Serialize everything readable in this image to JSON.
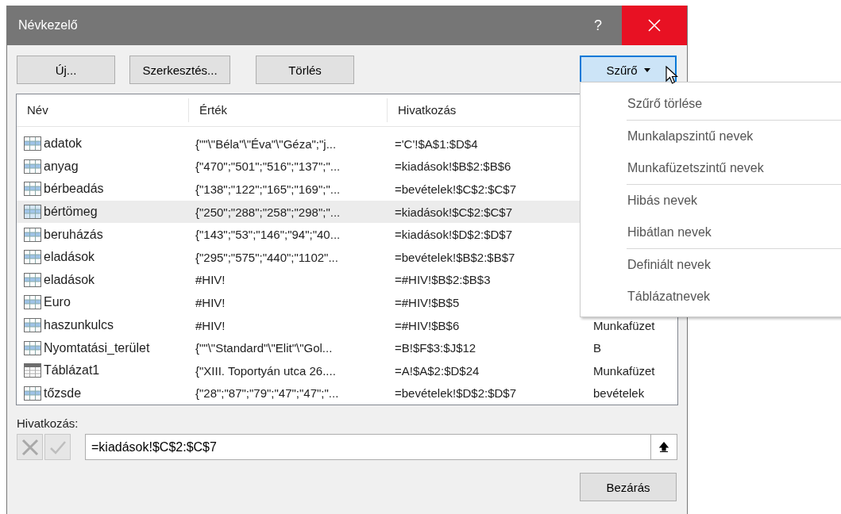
{
  "window": {
    "title": "Névkezelő",
    "help": "?"
  },
  "buttons": [
    {
      "label": "Új..."
    },
    {
      "label": "Szerkesztés..."
    },
    {
      "label": "Törlés"
    }
  ],
  "filter_button": {
    "label": "Szűrő",
    "pressed": true
  },
  "table": {
    "columns": [
      "Név",
      "Érték",
      "Hivatkozás"
    ],
    "rows": [
      {
        "kind": "name",
        "name": "adatok",
        "value": "{\"\"\\\"Béla\"\\\"Éva\"\\\"Géza\";\"j...",
        "ref": "='C'!$A$1:$D$4",
        "selected": false
      },
      {
        "kind": "name",
        "name": "anyag",
        "value": "{\"470\";\"501\";\"516\";\"137\";\"...",
        "ref": "=kiadások!$B$2:$B$6",
        "selected": false
      },
      {
        "kind": "name",
        "name": "bérbeadás",
        "value": "{\"138\";\"122\";\"165\";\"169\";\"...",
        "ref": "=bevételek!$C$2:$C$7",
        "selected": false
      },
      {
        "kind": "name",
        "name": "bértömeg",
        "value": "{\"250\";\"288\";\"258\";\"298\";\"...",
        "ref": "=kiadások!$C$2:$C$7",
        "selected": true
      },
      {
        "kind": "name",
        "name": "beruházás",
        "value": "{\"143\";\"53\";\"146\";\"94\";\"40...",
        "ref": "=kiadások!$D$2:$D$7",
        "selected": false
      },
      {
        "kind": "name",
        "name": "eladások",
        "value": "{\"295\";\"575\";\"440\";\"1102\"...",
        "ref": "=bevételek!$B$2:$B$7",
        "selected": false
      },
      {
        "kind": "name",
        "name": "eladások",
        "value": "#HIV!",
        "ref": "=#HIV!$B$2:$B$3",
        "selected": false
      },
      {
        "kind": "name",
        "name": "Euro",
        "value": "#HIV!",
        "ref": "=#HIV!$B$5",
        "selected": false
      },
      {
        "kind": "name",
        "name": "haszunkulcs",
        "value": "#HIV!",
        "ref": "=#HIV!$B$6",
        "scope": "Munkafüzet",
        "selected": false
      },
      {
        "kind": "name",
        "name": "Nyomtatási_terület",
        "value": "{\"\"\\\"Standard\"\\\"Elit\"\\\"Gol...",
        "ref": "=B!$F$3:$J$12",
        "scope": "B",
        "selected": false
      },
      {
        "kind": "table",
        "name": "Táblázat1",
        "value": "{\"XIII. Toportyán utca 26....",
        "ref": "=A!$A$2:$D$24",
        "scope": "Munkafüzet",
        "selected": false
      },
      {
        "kind": "name",
        "name": "tőzsde",
        "value": "{\"28\";\"87\";\"79\";\"47\";\"47\";\"...",
        "ref": "=bevételek!$D$2:$D$7",
        "scope": "bevételek",
        "selected": false
      }
    ]
  },
  "reference": {
    "label": "Hivatkozás:",
    "value": "=kiadások!$C$2:$C$7"
  },
  "close_button": "Bezárás",
  "filter_menu": {
    "groups": [
      [
        "Szűrő törlése"
      ],
      [
        "Munkalapszintű nevek",
        "Munkafüzetszintű nevek"
      ],
      [
        "Hibás nevek",
        "Hibátlan nevek"
      ],
      [
        "Definiált nevek",
        "Táblázatnevek"
      ]
    ]
  }
}
